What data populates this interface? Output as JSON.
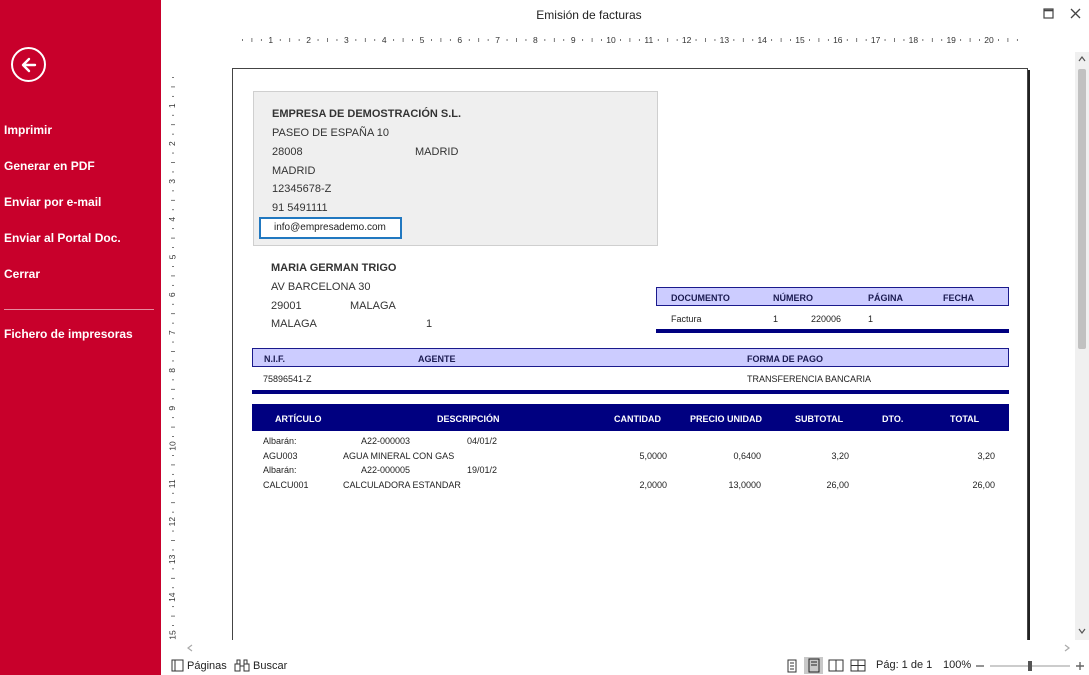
{
  "window": {
    "title": "Emisión de facturas"
  },
  "sidebar": {
    "items": [
      {
        "label": "Imprimir"
      },
      {
        "label": "Generar en PDF"
      },
      {
        "label": "Enviar por e-mail"
      },
      {
        "label": "Enviar al Portal Doc."
      },
      {
        "label": "Cerrar"
      }
    ],
    "extra": {
      "label": "Fichero de impresoras"
    }
  },
  "ruler": {
    "h": [
      "1",
      "2",
      "3",
      "4",
      "5",
      "6",
      "7",
      "8",
      "9",
      "10",
      "11",
      "12",
      "13",
      "14",
      "15",
      "16",
      "17",
      "18",
      "19",
      "20"
    ],
    "v": [
      "1",
      "2",
      "3",
      "4",
      "5",
      "6",
      "7",
      "8",
      "9",
      "10",
      "11",
      "12",
      "13",
      "14",
      "15"
    ]
  },
  "company": {
    "name": "EMPRESA DE DEMOSTRACIÓN S.L.",
    "address": "PASEO DE ESPAÑA 10",
    "zip": "28008",
    "city": "MADRID",
    "province": "MADRID",
    "nif": "12345678-Z",
    "phone": "91 5491111",
    "email": "info@empresademo.com"
  },
  "client": {
    "name": "MARIA GERMAN TRIGO",
    "address": "AV BARCELONA 30",
    "zip": "29001",
    "city": "MALAGA",
    "province": "MALAGA",
    "extra": "1"
  },
  "doc_header": {
    "labels": {
      "documento": "DOCUMENTO",
      "numero": "NÚMERO",
      "pagina": "PÁGINA",
      "fecha": "FECHA"
    },
    "values": {
      "documento": "Factura",
      "serie": "1",
      "numero": "220006",
      "pagina": "1"
    }
  },
  "payment_header": {
    "labels": {
      "nif": "N.I.F.",
      "agente": "AGENTE",
      "forma_pago": "FORMA DE PAGO"
    },
    "values": {
      "nif": "75896541-Z",
      "forma_pago": "TRANSFERENCIA BANCARIA"
    }
  },
  "table": {
    "headers": {
      "articulo": "ARTÍCULO",
      "descripcion": "DESCRIPCIÓN",
      "cantidad": "CANTIDAD",
      "precio": "PRECIO UNIDAD",
      "subtotal": "SUBTOTAL",
      "dto": "DTO.",
      "total": "TOTAL"
    },
    "albaran1": {
      "label": "Albarán:",
      "code": "A22-000003",
      "date": "04/01/2"
    },
    "line1": {
      "articulo": "AGU003",
      "descripcion": "AGUA MINERAL CON GAS",
      "cantidad": "5,0000",
      "precio": "0,6400",
      "subtotal": "3,20",
      "total": "3,20"
    },
    "albaran2": {
      "label": "Albarán:",
      "code": "A22-000005",
      "date": "19/01/2"
    },
    "line2": {
      "articulo": "CALCU001",
      "descripcion": "CALCULADORA ESTANDAR",
      "cantidad": "2,0000",
      "precio": "13,0000",
      "subtotal": "26,00",
      "total": "26,00"
    }
  },
  "statusbar": {
    "pages_label": "Páginas",
    "search_label": "Buscar",
    "page_info": "Pág: 1 de 1",
    "zoom": "100%"
  },
  "colors": {
    "sidebar": "#c8002b",
    "table_header": "#000080",
    "band": "#ccccff",
    "email_border": "#2178c0"
  },
  "icons": [
    "back-arrow-icon",
    "maximize-icon",
    "close-icon",
    "pages-icon",
    "binoculars-icon",
    "single-page-icon",
    "page-width-icon",
    "two-pages-icon",
    "four-pages-icon",
    "zoom-out-icon",
    "zoom-in-icon"
  ]
}
